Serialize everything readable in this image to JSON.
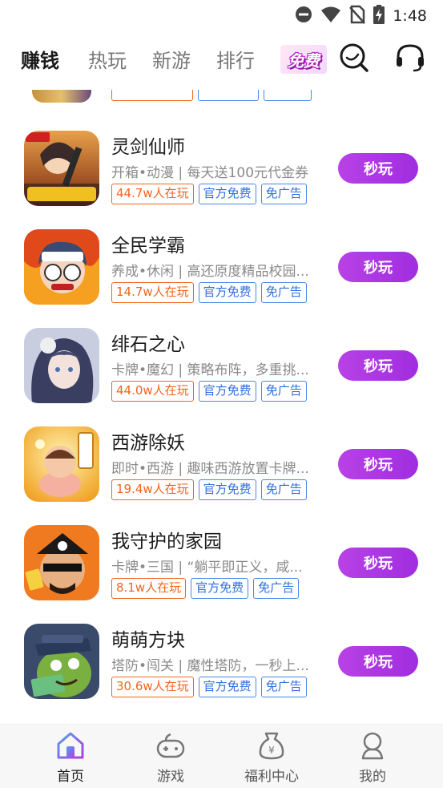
{
  "status_bar": {
    "time": "1:48"
  },
  "header": {
    "tabs": [
      {
        "label": "赚钱",
        "active": true
      },
      {
        "label": "热玩",
        "active": false
      },
      {
        "label": "新游",
        "active": false
      },
      {
        "label": "排行",
        "active": false
      }
    ],
    "free_badge": "免费",
    "icons": [
      "search-icon",
      "headset-icon"
    ]
  },
  "games": [
    {
      "name": "灵剑仙师",
      "desc": "开箱•动漫 | 每天送100元代金券",
      "players": "44.7w人在玩",
      "tag_official": "官方免费",
      "tag_noads": "免广告",
      "play": "秒玩"
    },
    {
      "name": "全民学霸",
      "desc": "养成•休闲 | 高还原度精品校园...",
      "players": "14.7w人在玩",
      "tag_official": "官方免费",
      "tag_noads": "免广告",
      "play": "秒玩"
    },
    {
      "name": "绯石之心",
      "desc": "卡牌•魔幻 | 策略布阵，多重挑...",
      "players": "44.0w人在玩",
      "tag_official": "官方免费",
      "tag_noads": "免广告",
      "play": "秒玩"
    },
    {
      "name": "西游除妖",
      "desc": "即时•西游 | 趣味西游放置卡牌...",
      "players": "19.4w人在玩",
      "tag_official": "官方免费",
      "tag_noads": "免广告",
      "play": "秒玩"
    },
    {
      "name": "我守护的家园",
      "desc": "卡牌•三国 | “躺平即正义，咸...",
      "players": "8.1w人在玩",
      "tag_official": "官方免费",
      "tag_noads": "免广告",
      "play": "秒玩"
    },
    {
      "name": "萌萌方块",
      "desc": "塔防•闯关 | 魔性塔防，一秒上...",
      "players": "30.6w人在玩",
      "tag_official": "官方免费",
      "tag_noads": "免广告",
      "play": "秒玩"
    }
  ],
  "bottom_nav": [
    {
      "label": "首页",
      "icon": "home-icon",
      "active": true
    },
    {
      "label": "游戏",
      "icon": "gamepad-icon",
      "active": false
    },
    {
      "label": "福利中心",
      "icon": "money-bag-icon",
      "active": false
    },
    {
      "label": "我的",
      "icon": "profile-icon",
      "active": false
    }
  ],
  "colors": {
    "accent": "#a735e3",
    "orange_tag": "#f2641e",
    "blue_tag": "#2f6fe0"
  }
}
